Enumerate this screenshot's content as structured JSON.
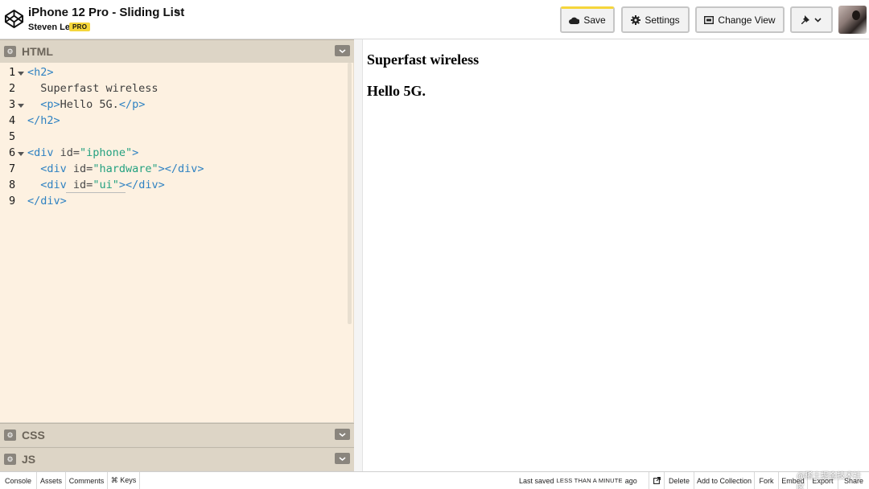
{
  "header": {
    "title": "iPhone 12 Pro - Sliding List",
    "author": "Steven Lei",
    "badge": "PRO",
    "buttons": {
      "save": "Save",
      "settings": "Settings",
      "change_view": "Change View"
    }
  },
  "panels": {
    "html": "HTML",
    "css": "CSS",
    "js": "JS"
  },
  "code": {
    "line_numbers": [
      "1",
      "2",
      "3",
      "4",
      "5",
      "6",
      "7",
      "8",
      "9"
    ]
  },
  "preview": {
    "heading": "Superfast wireless",
    "paragraph": "Hello 5G."
  },
  "footer": {
    "console": "Console",
    "assets": "Assets",
    "comments": "Comments",
    "keys": "⌘ Keys",
    "saved_prefix": "Last saved",
    "saved_time": "LESS THAN A MINUTE",
    "saved_suffix": "ago",
    "delete": "Delete",
    "add_to_collection": "Add to Collection",
    "fork": "Fork",
    "embed": "Embed",
    "export": "Export",
    "share": "Share"
  },
  "watermark": "@稀土掘金技术社区",
  "colors": {
    "accent_yellow": "#f5d63b",
    "editor_bg": "#fdf1e1",
    "tag": "#2f82c2",
    "string": "#24a180"
  }
}
